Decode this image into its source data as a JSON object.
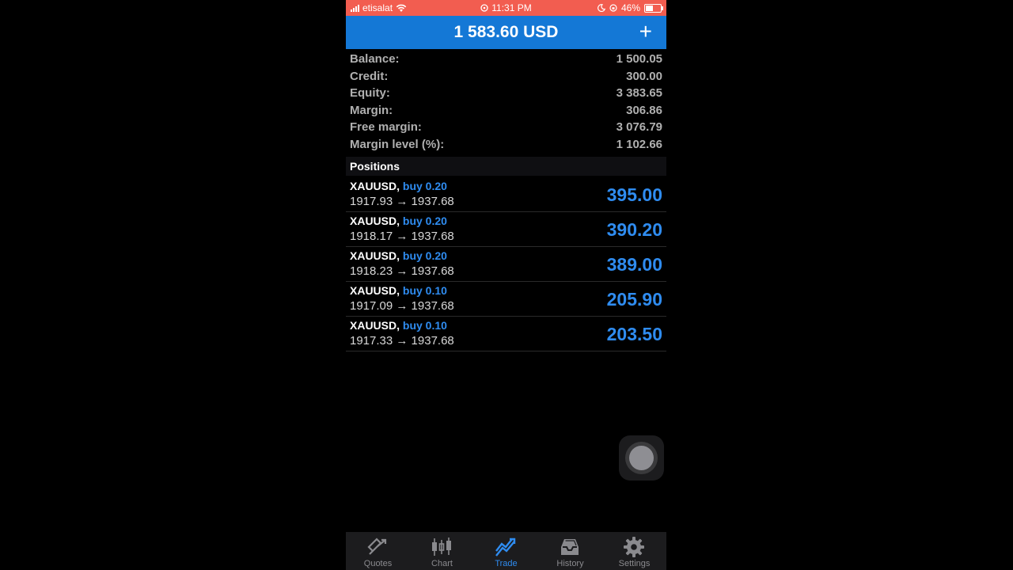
{
  "status_bar": {
    "carrier": "etisalat",
    "time": "11:31 PM",
    "battery": "46%",
    "battery_level": 0.46
  },
  "header": {
    "title": "1 583.60 USD",
    "add_icon": "plus-icon"
  },
  "account": [
    {
      "label": "Balance:",
      "value": "1 500.05"
    },
    {
      "label": "Credit:",
      "value": "300.00"
    },
    {
      "label": "Equity:",
      "value": "3 383.65"
    },
    {
      "label": "Margin:",
      "value": "306.86"
    },
    {
      "label": "Free margin:",
      "value": "3 076.79"
    },
    {
      "label": "Margin level (%):",
      "value": "1 102.66"
    }
  ],
  "positions_title": "Positions",
  "positions": [
    {
      "symbol": "XAUUSD,",
      "direction": "buy 0.20",
      "prices": "1917.93 → 1937.68",
      "profit": "395.00"
    },
    {
      "symbol": "XAUUSD,",
      "direction": "buy 0.20",
      "prices": "1918.17 → 1937.68",
      "profit": "390.20"
    },
    {
      "symbol": "XAUUSD,",
      "direction": "buy 0.20",
      "prices": "1918.23 → 1937.68",
      "profit": "389.00"
    },
    {
      "symbol": "XAUUSD,",
      "direction": "buy 0.10",
      "prices": "1917.09 → 1937.68",
      "profit": "205.90"
    },
    {
      "symbol": "XAUUSD,",
      "direction": "buy 0.10",
      "prices": "1917.33 → 1937.68",
      "profit": "203.50"
    }
  ],
  "tabs": [
    {
      "label": "Quotes",
      "icon": "quotes-icon",
      "active": false
    },
    {
      "label": "Chart",
      "icon": "candlestick-chart-icon",
      "active": false
    },
    {
      "label": "Trade",
      "icon": "trade-trend-icon",
      "active": true
    },
    {
      "label": "History",
      "icon": "history-inbox-icon",
      "active": false
    },
    {
      "label": "Settings",
      "icon": "gear-icon",
      "active": false
    }
  ],
  "colors": {
    "status_bar": "#f25d50",
    "header": "#1478d6",
    "accent_blue": "#2f8cf0",
    "tab_bar": "#1c1c1e"
  }
}
